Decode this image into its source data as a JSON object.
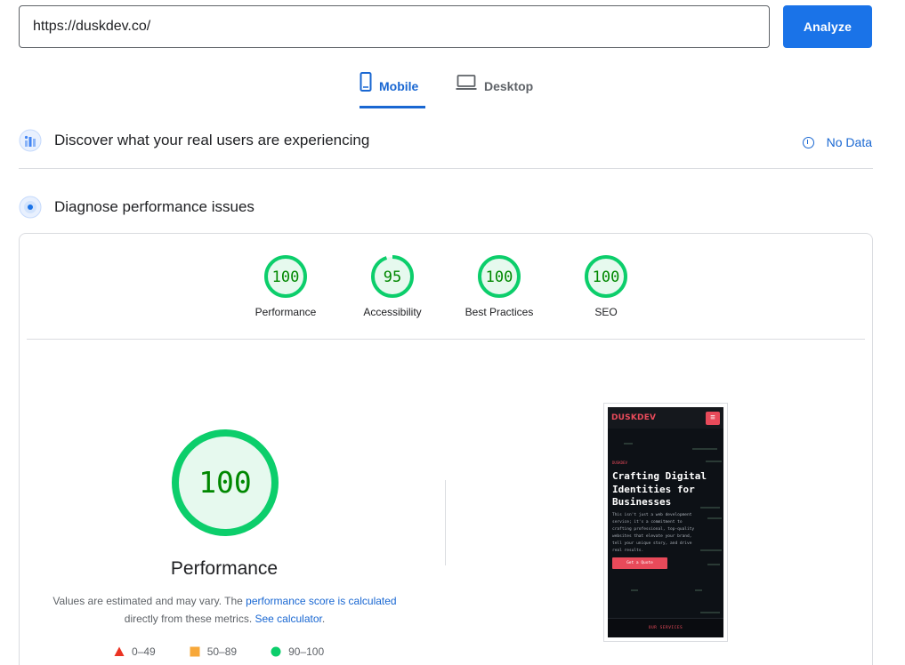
{
  "header": {
    "url_value": "https://duskdev.co/",
    "analyze_label": "Analyze"
  },
  "tabs": [
    {
      "label": "Mobile",
      "active": true
    },
    {
      "label": "Desktop",
      "active": false
    }
  ],
  "crux": {
    "title": "Discover what your real users are experiencing",
    "status": "No Data"
  },
  "diagnose": {
    "title": "Diagnose performance issues"
  },
  "scores": [
    {
      "label": "Performance",
      "value": "100",
      "fraction": 1.0
    },
    {
      "label": "Accessibility",
      "value": "95",
      "fraction": 0.95
    },
    {
      "label": "Best Practices",
      "value": "100",
      "fraction": 1.0
    },
    {
      "label": "SEO",
      "value": "100",
      "fraction": 1.0
    }
  ],
  "main_gauge": {
    "value": "100",
    "fraction": 1.0,
    "title": "Performance"
  },
  "description": {
    "text_before": "Values are estimated and may vary. The ",
    "link1": "performance score is calculated",
    "text_middle": " directly from these metrics. ",
    "link2": "See calculator",
    "text_after": "."
  },
  "legend": [
    {
      "range": "0–49",
      "shape": "triangle",
      "color": "#eb3323"
    },
    {
      "range": "50–89",
      "shape": "square",
      "color": "#f7a83a"
    },
    {
      "range": "90–100",
      "shape": "circle",
      "color": "#0cce6b"
    }
  ],
  "screenshot": {
    "logo": "DUSKDEV",
    "menu_glyph": "≡",
    "kicker": "DUSKDEV",
    "headline": "Crafting Digital Identities for Businesses",
    "body": "This isn't just a web development service; it's a commitment to crafting professional, top-quality websites that elevate your brand, tell your unique story, and drive real results.",
    "cta": "Get a Quote",
    "bottom": "OUR SERVICES"
  },
  "colors": {
    "accent": "#1a73e8",
    "pass": "#0cce6b",
    "pass_text": "#008800",
    "pass_fill": "#e6f9ee"
  }
}
